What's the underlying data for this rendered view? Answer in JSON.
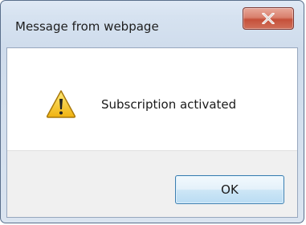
{
  "dialog": {
    "title": "Message from webpage",
    "message": "Subscription activated",
    "ok_label": "OK"
  },
  "icons": {
    "close": "close-icon",
    "status": "warning-icon"
  },
  "colors": {
    "close_button": "#c5503a",
    "ok_button": "#b9dcf3",
    "warning_fill": "#f5cc27"
  }
}
